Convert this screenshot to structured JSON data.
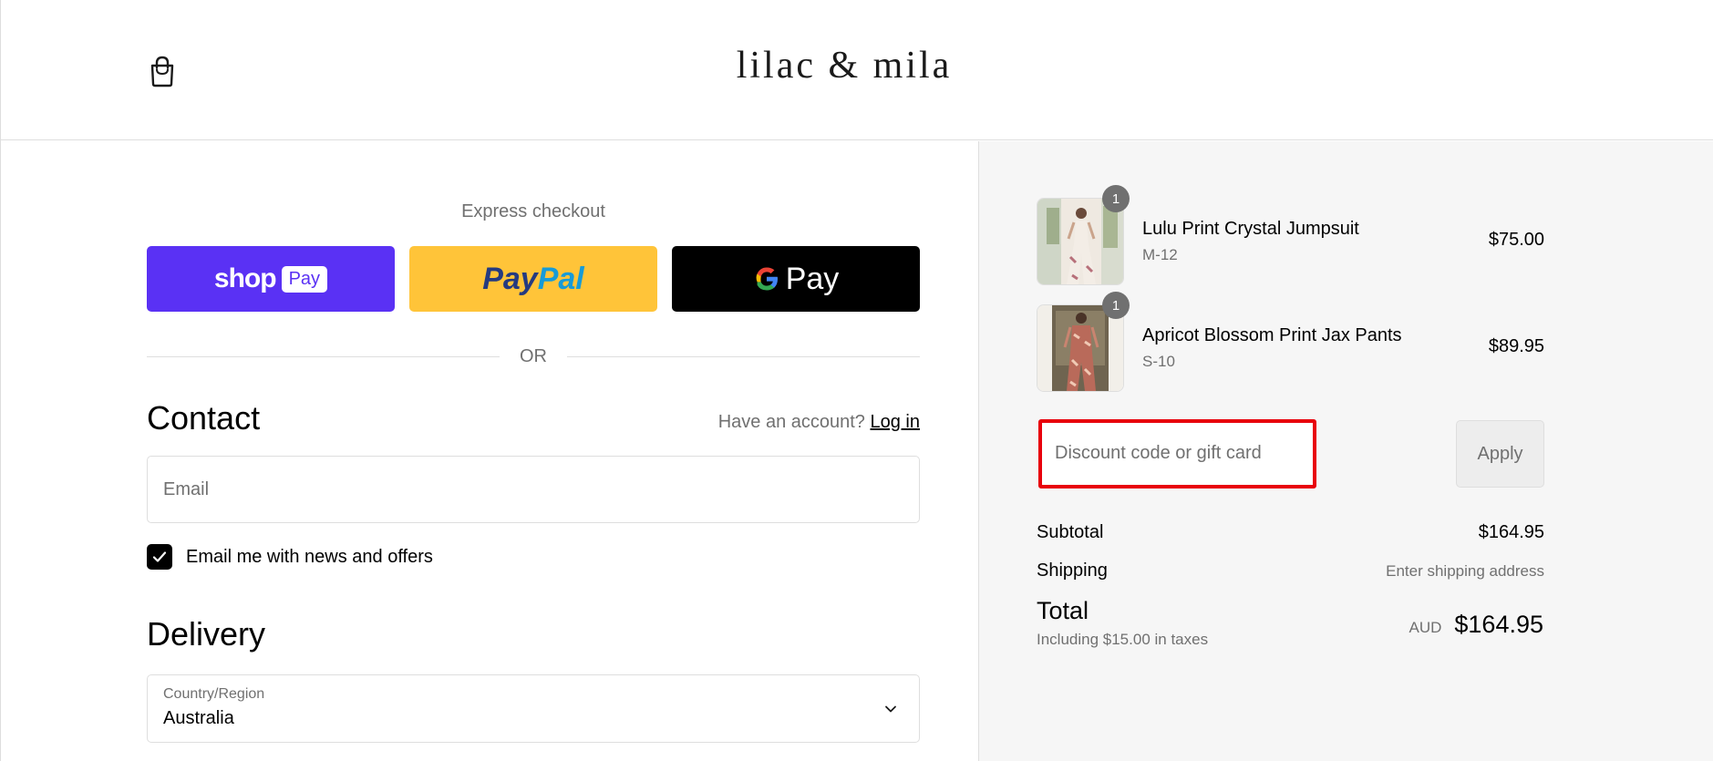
{
  "header": {
    "logo_text": "lilac & mila",
    "cart_icon": "shopping-bag-icon"
  },
  "express_checkout": {
    "title": "Express checkout",
    "shop_pay": {
      "shop": "shop",
      "pay": "Pay"
    },
    "paypal": {
      "pay": "Pay",
      "pal": "Pal"
    },
    "gpay": {
      "g": "G",
      "pay": "Pay"
    },
    "or_text": "OR"
  },
  "contact": {
    "title": "Contact",
    "account_prompt": "Have an account?",
    "login_label": "Log in",
    "email_placeholder": "Email",
    "newsletter_label": "Email me with news and offers",
    "newsletter_checked": true
  },
  "delivery": {
    "title": "Delivery",
    "country_label": "Country/Region",
    "country_value": "Australia"
  },
  "order_summary": {
    "items": [
      {
        "quantity": "1",
        "name": "Lulu Print Crystal Jumpsuit",
        "variant": "M-12",
        "price": "$75.00"
      },
      {
        "quantity": "1",
        "name": "Apricot Blossom Print Jax Pants",
        "variant": "S-10",
        "price": "$89.95"
      }
    ],
    "discount_placeholder": "Discount code or gift card",
    "apply_label": "Apply",
    "subtotal_label": "Subtotal",
    "subtotal_value": "$164.95",
    "shipping_label": "Shipping",
    "shipping_value": "Enter shipping address",
    "total_label": "Total",
    "taxes_note": "Including $15.00 in taxes",
    "currency": "AUD",
    "total_value": "$164.95"
  },
  "colors": {
    "shop_pay": "#5a31f4",
    "paypal": "#ffc439",
    "gpay": "#000000",
    "highlight": "#e8000b"
  }
}
